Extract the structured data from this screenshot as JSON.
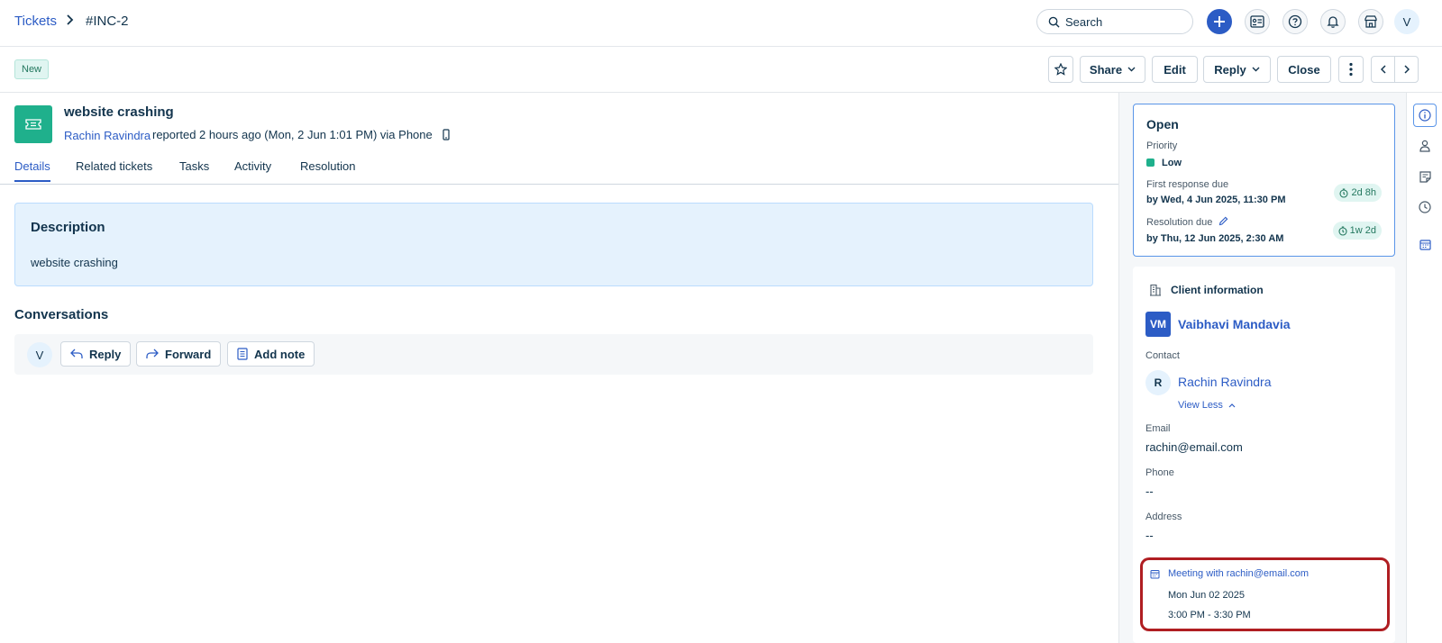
{
  "breadcrumb": {
    "root": "Tickets",
    "separator": "›",
    "current": "#INC-2"
  },
  "topbar": {
    "search_placeholder": "Search",
    "avatar_initial": "V",
    "plus": "+"
  },
  "actions": {
    "status_badge": "New",
    "share": "Share",
    "edit": "Edit",
    "reply": "Reply",
    "close": "Close"
  },
  "ticket": {
    "title": "website crashing",
    "reporter": "Rachin Ravindra",
    "reported_text": "reported 2 hours ago (Mon, 2 Jun 1:01 PM) via Phone"
  },
  "tabs": [
    {
      "label": "Details",
      "active": true
    },
    {
      "label": "Related tickets"
    },
    {
      "label": "Tasks"
    },
    {
      "label": "Activity"
    },
    {
      "label": "Resolution"
    }
  ],
  "description": {
    "heading": "Description",
    "text": "website crashing"
  },
  "conversations": {
    "heading": "Conversations",
    "avatar_initial": "V",
    "reply": "Reply",
    "forward": "Forward",
    "add_note": "Add note"
  },
  "status_card": {
    "status": "Open",
    "priority_label": "Priority",
    "priority_value": "Low",
    "priority_color": "#1fb08c",
    "first_response_label": "First response due",
    "first_response_value": "by Wed, 4 Jun 2025, 11:30 PM",
    "first_response_sla": "2d 8h",
    "resolution_label": "Resolution due",
    "resolution_value": "by Thu, 12 Jun 2025, 2:30 AM",
    "resolution_sla": "1w 2d"
  },
  "client": {
    "heading": "Client information",
    "company_initials": "VM",
    "company_name": "Vaibhavi Mandavia",
    "contact_label": "Contact",
    "contact_initial": "R",
    "contact_name": "Rachin Ravindra",
    "view_less": "View Less",
    "email_label": "Email",
    "email_value": "rachin@email.com",
    "phone_label": "Phone",
    "phone_value": "--",
    "address_label": "Address",
    "address_value": "--"
  },
  "meeting": {
    "title": "Meeting with rachin@email.com",
    "date": "Mon Jun 02 2025",
    "time": "3:00 PM - 3:30 PM"
  },
  "colors": {
    "accent": "#2c5cc5",
    "ticket_icon": "#1fb08c",
    "highlight_border": "#b01e22"
  }
}
